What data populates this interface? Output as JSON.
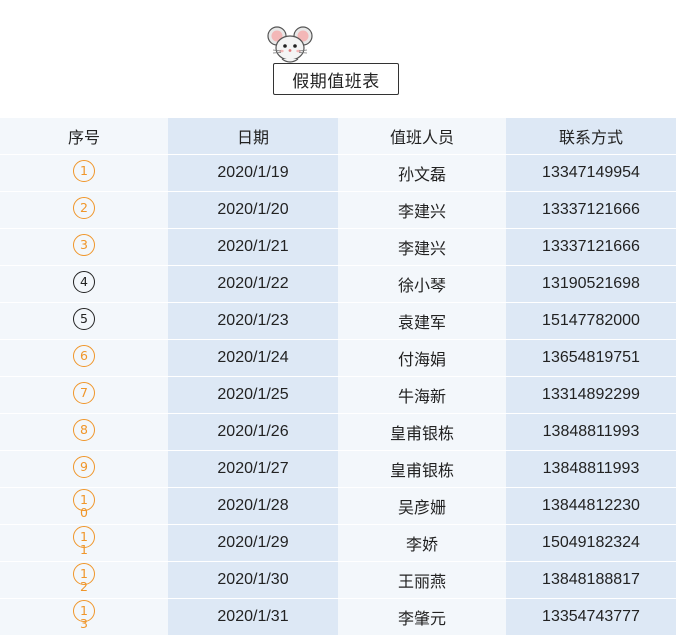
{
  "title": "假期值班表",
  "columns": [
    "序号",
    "日期",
    "值班人员",
    "联系方式"
  ],
  "rows": [
    {
      "seq": "1",
      "seq_head": "1",
      "seq_tail": "",
      "seq_color": "orange",
      "date": "2020/1/19",
      "person": "孙文磊",
      "phone": "13347149954"
    },
    {
      "seq": "2",
      "seq_head": "2",
      "seq_tail": "",
      "seq_color": "orange",
      "date": "2020/1/20",
      "person": "李建兴",
      "phone": "13337121666"
    },
    {
      "seq": "3",
      "seq_head": "3",
      "seq_tail": "",
      "seq_color": "orange",
      "date": "2020/1/21",
      "person": "李建兴",
      "phone": "13337121666"
    },
    {
      "seq": "4",
      "seq_head": "4",
      "seq_tail": "",
      "seq_color": "black",
      "date": "2020/1/22",
      "person": "徐小琴",
      "phone": "13190521698"
    },
    {
      "seq": "5",
      "seq_head": "5",
      "seq_tail": "",
      "seq_color": "black",
      "date": "2020/1/23",
      "person": "袁建军",
      "phone": "15147782000"
    },
    {
      "seq": "6",
      "seq_head": "6",
      "seq_tail": "",
      "seq_color": "orange",
      "date": "2020/1/24",
      "person": "付海娟",
      "phone": "13654819751"
    },
    {
      "seq": "7",
      "seq_head": "7",
      "seq_tail": "",
      "seq_color": "orange",
      "date": "2020/1/25",
      "person": "牛海新",
      "phone": "13314892299"
    },
    {
      "seq": "8",
      "seq_head": "8",
      "seq_tail": "",
      "seq_color": "orange",
      "date": "2020/1/26",
      "person": "皇甫银栋",
      "phone": "13848811993"
    },
    {
      "seq": "9",
      "seq_head": "9",
      "seq_tail": "",
      "seq_color": "orange",
      "date": "2020/1/27",
      "person": "皇甫银栋",
      "phone": "13848811993"
    },
    {
      "seq": "10",
      "seq_head": "1",
      "seq_tail": "0",
      "seq_color": "orange",
      "date": "2020/1/28",
      "person": "吴彦姗",
      "phone": "13844812230"
    },
    {
      "seq": "11",
      "seq_head": "1",
      "seq_tail": "1",
      "seq_color": "orange",
      "date": "2020/1/29",
      "person": "李娇",
      "phone": "15049182324"
    },
    {
      "seq": "12",
      "seq_head": "1",
      "seq_tail": "2",
      "seq_color": "orange",
      "date": "2020/1/30",
      "person": "王丽燕",
      "phone": "13848188817"
    },
    {
      "seq": "13",
      "seq_head": "1",
      "seq_tail": "3",
      "seq_color": "orange",
      "date": "2020/1/31",
      "person": "李肇元",
      "phone": "13354743777"
    }
  ],
  "colors": {
    "seq_orange": "#f0962a",
    "seq_black": "#222222",
    "col_light": "#f3f7fb",
    "col_dark": "#dde8f5"
  },
  "icons": {
    "title_decoration": "mouse-icon"
  }
}
